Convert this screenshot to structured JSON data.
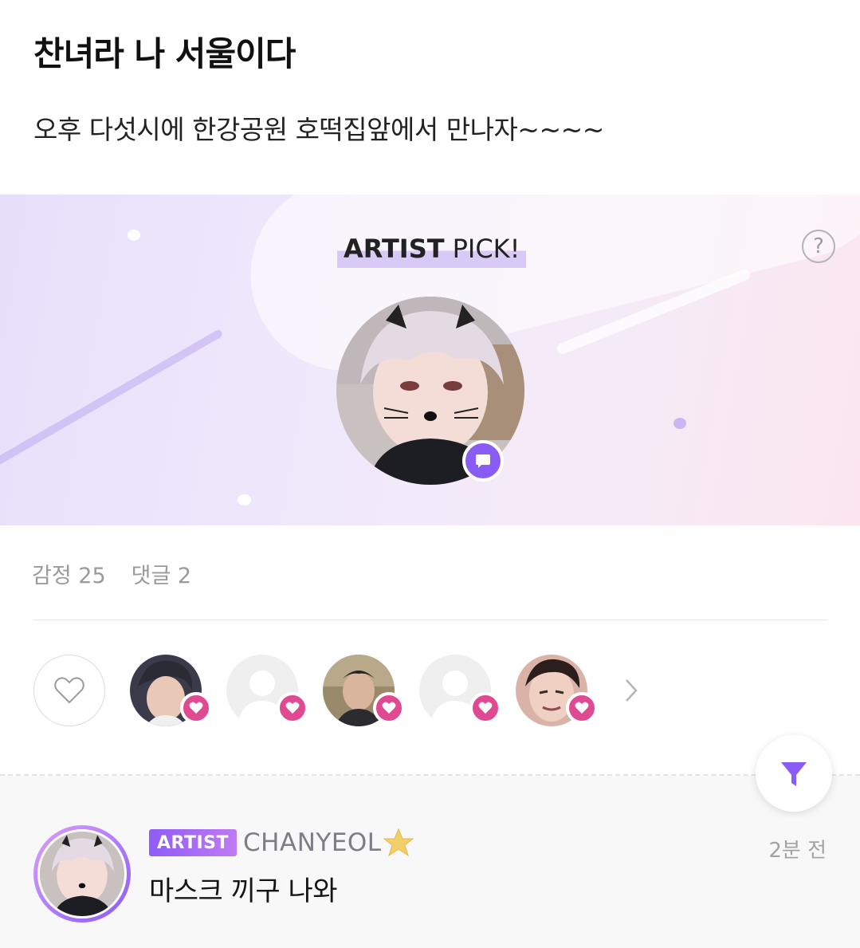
{
  "post": {
    "title": "찬녀라 나 서울이다",
    "body": "오후 다섯시에 한강공원 호떡집앞에서 만나자~~~~"
  },
  "artist_pick": {
    "label_strong": "ARTIST",
    "label_rest": "PICK!",
    "help_icon": "question-circle-icon",
    "help_symbol": "?",
    "bubble_icon": "chat-bubble-icon"
  },
  "stats": {
    "emotion": "감정 25",
    "comments": "댓글 2"
  },
  "reactions": {
    "like_icon": "heart-outline-icon",
    "badge_icon": "heart-icon",
    "more_icon": "chevron-right-icon",
    "badge_color": "#e04a93"
  },
  "filter": {
    "icon": "filter-icon",
    "color": "#8a5cf6"
  },
  "comment": {
    "badge": "ARTIST",
    "author": "CHANYEOL",
    "author_icon": "star-icon",
    "time": "2분 전",
    "text": "마스크 끼구 나와"
  },
  "colors": {
    "accent": "#8a5cf6",
    "heart": "#e04a93",
    "muted": "#9a9a9a"
  }
}
